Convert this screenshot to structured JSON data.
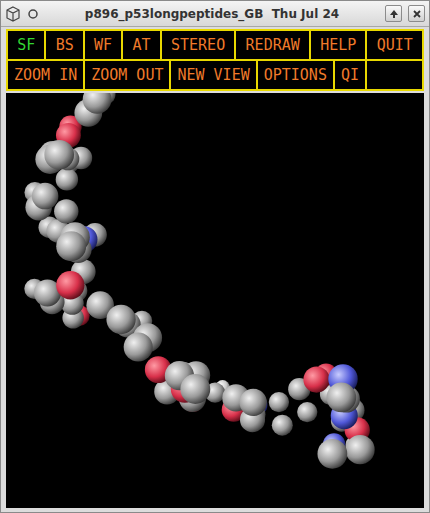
{
  "window": {
    "title": "p896_p53longpeptides_GB  Thu Jul 24"
  },
  "toolbar": {
    "rows": [
      [
        {
          "label": "SF",
          "selected": true
        },
        {
          "label": "BS",
          "selected": false
        },
        {
          "label": "WF",
          "selected": false
        },
        {
          "label": "AT",
          "selected": false
        },
        {
          "label": "STEREO",
          "selected": false
        },
        {
          "label": "REDRAW",
          "selected": false
        },
        {
          "label": "HELP",
          "selected": false
        },
        {
          "label": "QUIT",
          "selected": false
        }
      ],
      [
        {
          "label": "ZOOM IN",
          "selected": false
        },
        {
          "label": "ZOOM OUT",
          "selected": false
        },
        {
          "label": "NEW VIEW",
          "selected": false
        },
        {
          "label": "OPTIONS",
          "selected": false
        },
        {
          "label": "QI",
          "selected": false
        }
      ]
    ]
  }
}
